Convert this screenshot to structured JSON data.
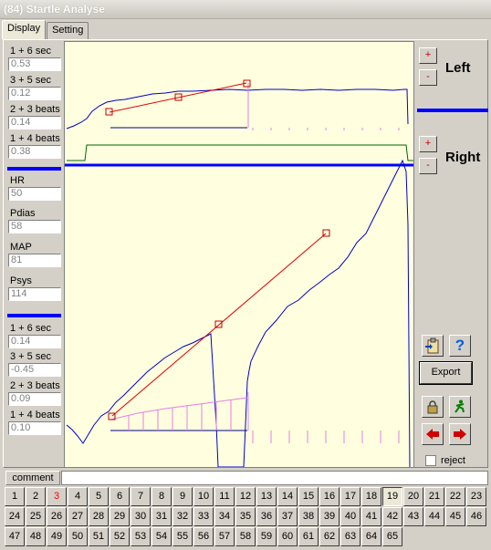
{
  "window": {
    "title": "(84) Startle Analyse"
  },
  "tabs": [
    {
      "label": "Display"
    },
    {
      "label": "Setting"
    }
  ],
  "left_fields": [
    {
      "label": "1 + 6 sec",
      "value": "0.53"
    },
    {
      "label": "3 + 5 sec",
      "value": "0.12"
    },
    {
      "label": "2 + 3 beats",
      "value": "0.14"
    },
    {
      "label": "1 + 4 beats",
      "value": "0.38"
    },
    {
      "label": "HR",
      "value": "50"
    },
    {
      "label": "Pdias",
      "value": "58"
    },
    {
      "label": "MAP",
      "value": "81"
    },
    {
      "label": "Psys",
      "value": "114"
    },
    {
      "label": "1 + 6 sec",
      "value": "0.14"
    },
    {
      "label": "3 + 5 sec",
      "value": "-0.45"
    },
    {
      "label": "2 + 3 beats",
      "value": "0.09"
    },
    {
      "label": "1 + 4 beats",
      "value": "0.10"
    }
  ],
  "side": {
    "left_label": "Left",
    "right_label": "Right",
    "plus": "+",
    "minus": "-",
    "export_label": "Export",
    "reject_label": "reject",
    "help": "?"
  },
  "comment": {
    "label": "comment",
    "value": ""
  },
  "trial_buttons": {
    "labels": [
      "1",
      "2",
      "3",
      "4",
      "5",
      "6",
      "7",
      "8",
      "9",
      "10",
      "11",
      "12",
      "13",
      "14",
      "15",
      "16",
      "17",
      "18",
      "19",
      "20",
      "21",
      "22",
      "23",
      "24",
      "25",
      "26",
      "27",
      "28",
      "29",
      "30",
      "31",
      "32",
      "33",
      "34",
      "35",
      "36",
      "37",
      "38",
      "39",
      "40",
      "41",
      "42",
      "43",
      "44",
      "45",
      "46",
      "47",
      "48",
      "49",
      "50",
      "51",
      "52",
      "53",
      "54",
      "55",
      "56",
      "57",
      "58",
      "59",
      "60",
      "61",
      "62",
      "63",
      "64",
      "65"
    ],
    "selected": "19",
    "highlighted": "3"
  },
  "colors": {
    "trace": "#0000c8",
    "fit": "#e00000",
    "pulse": "#e080e0",
    "baseline": "#000080",
    "hr": "#006400",
    "accent": "#0000ff"
  },
  "icons": [
    "clipboard-icon",
    "help-icon",
    "lock-icon",
    "running-man-icon",
    "arrow-left-icon",
    "arrow-right-icon"
  ]
}
